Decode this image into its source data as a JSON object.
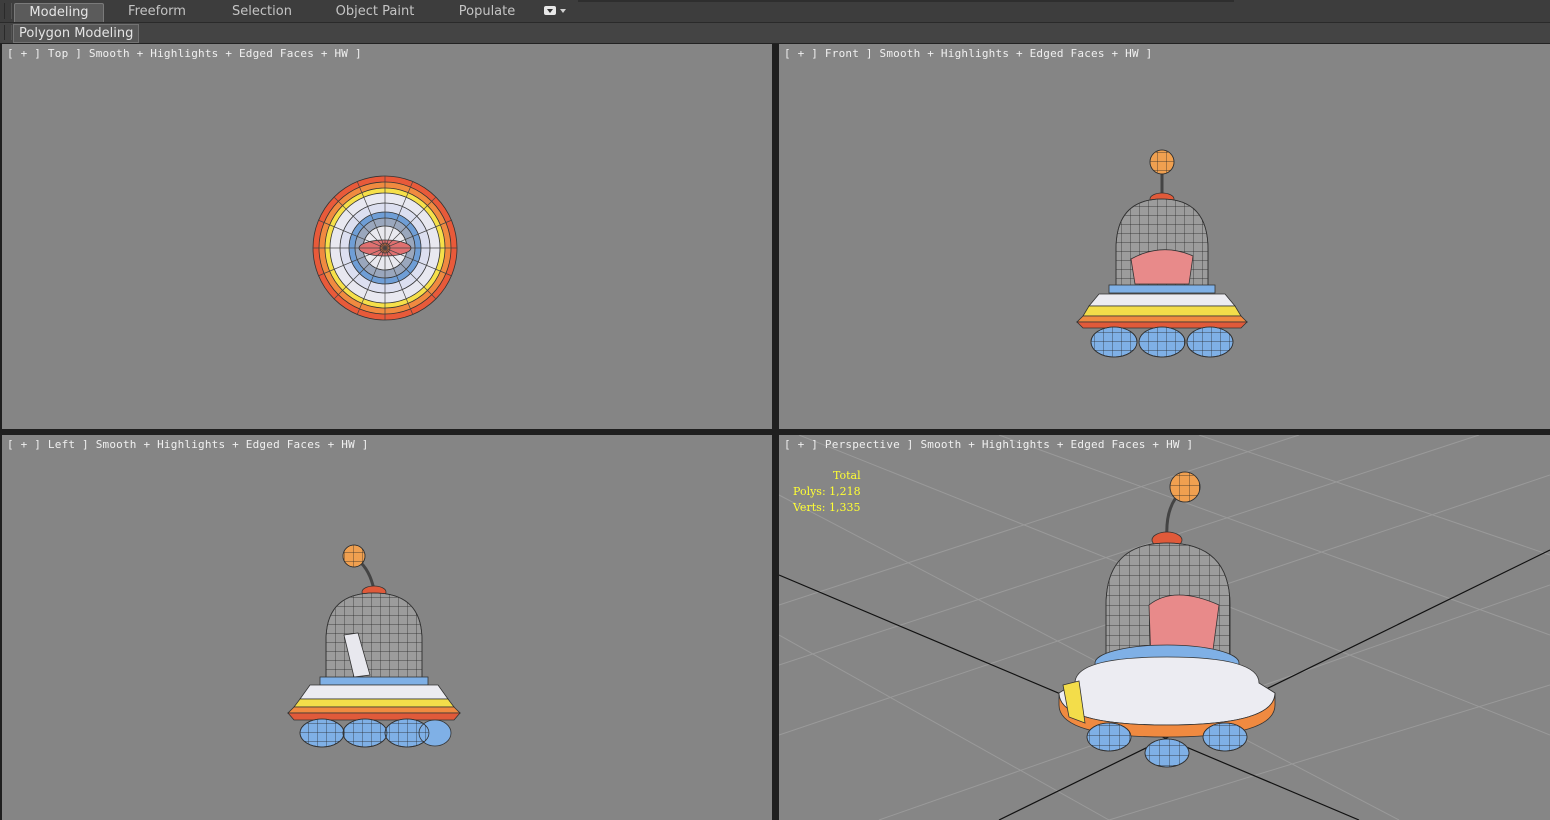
{
  "ribbon": {
    "tabs": [
      {
        "label": "Modeling",
        "active": true
      },
      {
        "label": "Freeform",
        "active": false
      },
      {
        "label": "Selection",
        "active": false
      },
      {
        "label": "Object Paint",
        "active": false
      },
      {
        "label": "Populate",
        "active": false
      }
    ],
    "dropdown_icon": "ribbon-options-icon",
    "panel_label": "Polygon Modeling"
  },
  "viewports": {
    "top": {
      "label": "[ + ] Top ] Smooth + Highlights + Edged Faces + HW ]"
    },
    "front": {
      "label": "[ + ] Front ] Smooth + Highlights + Edged Faces + HW ]"
    },
    "left": {
      "label": "[ + ] Left ] Smooth + Highlights + Edged Faces + HW ]"
    },
    "perspective": {
      "label": "[ + ] Perspective ] Smooth + Highlights + Edged Faces + HW ]"
    }
  },
  "stats": {
    "heading": "Total",
    "polys": "Polys: 1,218",
    "verts": "Verts: 1,335"
  },
  "colors": {
    "viewport_bg": "#858585",
    "stats_text": "#ffff33",
    "ufo_orange": "#f07a3a",
    "ufo_red": "#e0503a",
    "ufo_yellow": "#f6e04a",
    "ufo_blue": "#7fb0e0",
    "ufo_dome": "#9a9a9a"
  }
}
